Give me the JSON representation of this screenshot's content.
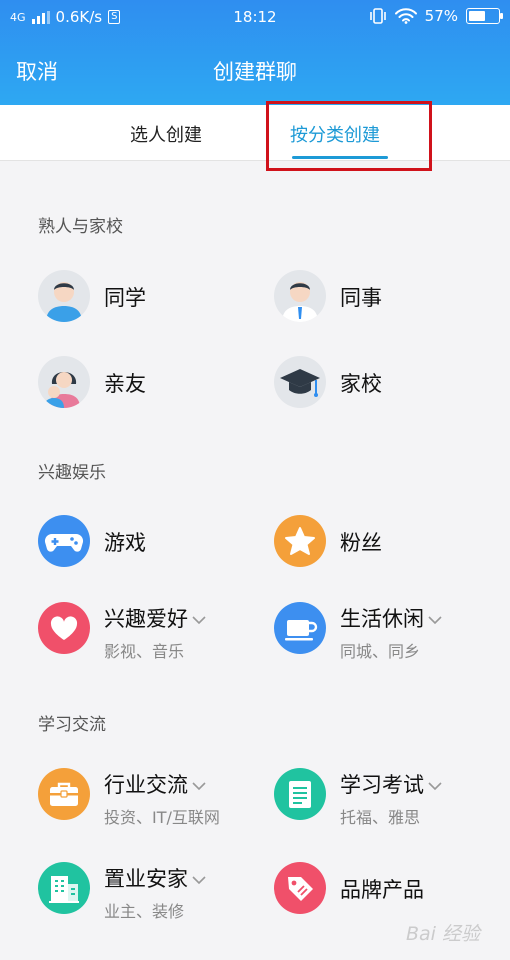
{
  "status_bar": {
    "network": "4G",
    "speed": "0.6K/s",
    "sim_icon": "S",
    "time": "18:12",
    "battery": "57%",
    "battery_level": 0.57
  },
  "nav": {
    "cancel_label": "取消",
    "title": "创建群聊"
  },
  "tabs": [
    {
      "label": "选人创建",
      "active": false
    },
    {
      "label": "按分类创建",
      "active": true
    }
  ],
  "sections": [
    {
      "title": "熟人与家校",
      "items": [
        {
          "label": "同学",
          "icon": "classmate-avatar-icon"
        },
        {
          "label": "同事",
          "icon": "colleague-avatar-icon"
        },
        {
          "label": "亲友",
          "icon": "family-avatar-icon"
        },
        {
          "label": "家校",
          "icon": "graduation-cap-icon"
        }
      ]
    },
    {
      "title": "兴趣娱乐",
      "items": [
        {
          "label": "游戏",
          "icon": "gamepad-icon"
        },
        {
          "label": "粉丝",
          "icon": "star-icon"
        },
        {
          "label": "兴趣爱好",
          "sub": "影视、音乐",
          "icon": "heart-icon",
          "dropdown": true
        },
        {
          "label": "生活休闲",
          "sub": "同城、同乡",
          "icon": "coffee-cup-icon",
          "dropdown": true
        }
      ]
    },
    {
      "title": "学习交流",
      "items": [
        {
          "label": "行业交流",
          "sub": "投资、IT/互联网",
          "icon": "briefcase-icon",
          "dropdown": true
        },
        {
          "label": "学习考试",
          "sub": "托福、雅思",
          "icon": "notebook-icon",
          "dropdown": true
        },
        {
          "label": "置业安家",
          "sub": "业主、装修",
          "icon": "building-icon",
          "dropdown": true
        },
        {
          "label": "品牌产品",
          "icon": "price-tag-icon"
        }
      ]
    }
  ],
  "colors": {
    "header": "#2f8ef0",
    "accent": "#1d9ad6",
    "highlight_box": "#d0121b",
    "game": "#3d8ff0",
    "fans": "#f4a03a",
    "hobby": "#f0506a",
    "life": "#3d8ff0",
    "industry": "#f4a03a",
    "study": "#20c3a0",
    "home": "#20c3a0",
    "brand": "#f0506a"
  },
  "watermark": "Bai 经验"
}
